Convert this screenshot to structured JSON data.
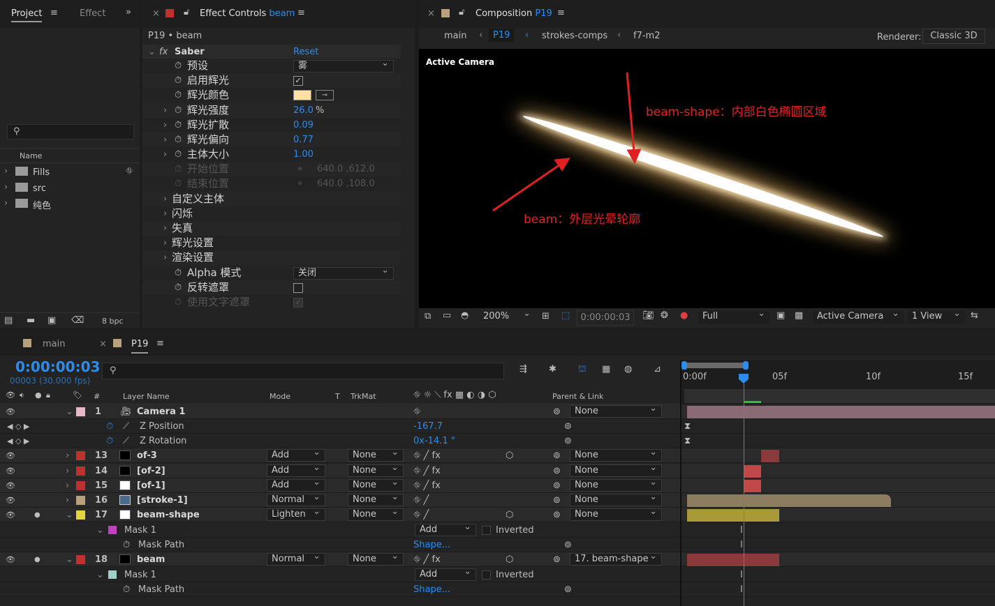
{
  "project": {
    "tab": "Project",
    "tab2": "Effect",
    "menu": "≡",
    "search_icon": "search-icon",
    "col_name": "Name",
    "items": [
      "Fills",
      "src",
      "纯色"
    ],
    "bpc": "8 bpc"
  },
  "effect_controls": {
    "title_prefix": "Effect Controls",
    "layer": "beam",
    "menu": "≡",
    "breadcrumb": "P19 • beam",
    "effect_name": "Saber",
    "reset": "Reset",
    "props": [
      {
        "label": "预设",
        "value": "雾",
        "type": "dropdown"
      },
      {
        "label": "启用辉光",
        "value": "",
        "type": "checkbox"
      },
      {
        "label": "辉光颜色",
        "value": "",
        "type": "color"
      },
      {
        "label": "辉光强度",
        "value": "26.0",
        "unit": "%"
      },
      {
        "label": "辉光扩散",
        "value": "0.09"
      },
      {
        "label": "辉光偏向",
        "value": "0.77"
      },
      {
        "label": "主体大小",
        "value": "1.00"
      },
      {
        "label": "开始位置",
        "value": "640.0 ,612.0"
      },
      {
        "label": "结束位置",
        "value": "640.0 ,108.0"
      },
      {
        "label": "自定义主体"
      },
      {
        "label": "闪烁"
      },
      {
        "label": "失真"
      },
      {
        "label": "辉光设置"
      },
      {
        "label": "渲染设置"
      },
      {
        "label": "Alpha 模式",
        "value": "关闭",
        "type": "dropdown"
      },
      {
        "label": "反转遮罩",
        "type": "checkbox"
      },
      {
        "label": "使用文字遮罩",
        "type": "checkbox"
      }
    ]
  },
  "composition": {
    "title_prefix": "Composition",
    "comp": "P19",
    "menu": "≡",
    "breadcrumbs": [
      "main",
      "P19",
      "strokes-comps",
      "f7-m2"
    ],
    "renderer_label": "Renderer:",
    "renderer": "Classic 3D",
    "active_camera": "Active Camera",
    "annotation1": "beam-shape：内部白色椭圆区域",
    "annotation2": "beam：外层光晕轮廓",
    "zoom": "200%",
    "time": "0:00:00:03",
    "resolution": "Full",
    "view_camera": "Active Camera",
    "views": "1 View"
  },
  "timeline": {
    "tabs": [
      "main",
      "P19"
    ],
    "menu": "≡",
    "timecode": "0:00:00:03",
    "frames": "00003 (30.000 fps)",
    "headers": {
      "num": "#",
      "layer_name": "Layer Name",
      "mode": "Mode",
      "t": "T",
      "trkmat": "TrkMat",
      "parent": "Parent & Link"
    },
    "ruler": [
      "0:00f",
      "05f",
      "10f",
      "15f"
    ],
    "rows": [
      {
        "num": "1",
        "name": "Camera 1",
        "mode": "",
        "trk": "",
        "parent": "None"
      },
      {
        "sub": "Z Position",
        "value": "-167.7"
      },
      {
        "sub": "Z Rotation",
        "value": "0x-14.1 °"
      },
      {
        "num": "13",
        "name": "of-3",
        "mode": "Add",
        "trk": "None",
        "parent": "None"
      },
      {
        "num": "14",
        "name": "[of-2]",
        "mode": "Add",
        "trk": "None",
        "parent": "None"
      },
      {
        "num": "15",
        "name": "[of-1]",
        "mode": "Add",
        "trk": "None",
        "parent": "None"
      },
      {
        "num": "16",
        "name": "[stroke-1]",
        "mode": "Normal",
        "trk": "None",
        "parent": "None"
      },
      {
        "num": "17",
        "name": "beam-shape",
        "mode": "Lighten",
        "trk": "None",
        "parent": "None"
      },
      {
        "mask": "Mask 1",
        "mask_mode": "Add",
        "inverted": "Inverted"
      },
      {
        "mask_path": "Mask Path",
        "shape": "Shape..."
      },
      {
        "num": "18",
        "name": "beam",
        "mode": "Normal",
        "trk": "None",
        "parent": "17. beam-shape"
      },
      {
        "mask": "Mask 1",
        "mask_mode": "Add",
        "inverted": "Inverted"
      },
      {
        "mask_path": "Mask Path",
        "shape": "Shape..."
      }
    ]
  }
}
